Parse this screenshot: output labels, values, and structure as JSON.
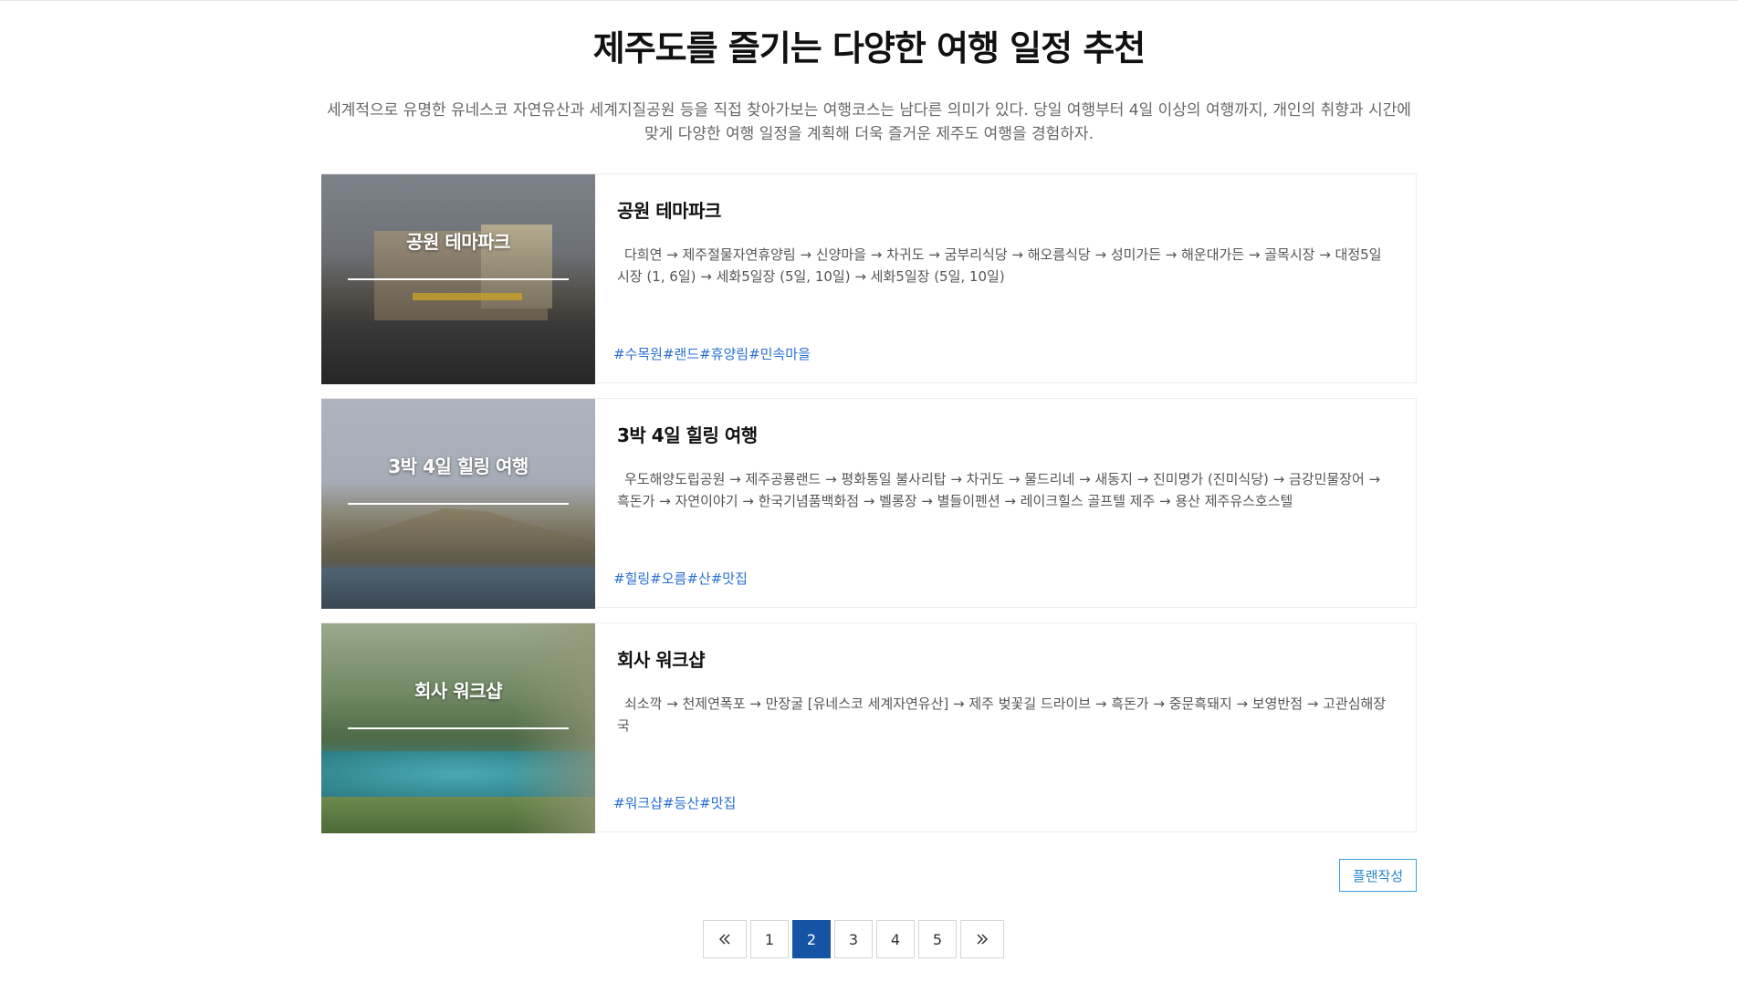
{
  "header": {
    "title": "제주도를 즐기는 다양한 여행 일정 추천",
    "description": "세계적으로 유명한 유네스코 자연유산과 세계지질공원 등을 직접 찾아가보는 여행코스는 남다른 의미가 있다. 당일 여행부터 4일 이상의 여행까지, 개인의 취향과 시간에 맞게 다양한 여행 일정을 계획해 더욱 즐거운 제주도 여행을 경험하자."
  },
  "courses": [
    {
      "thumb_label": "공원 테마파크",
      "title": "공원 테마파크",
      "route": "다희연 → 제주절물자연휴양림 → 신양마을 → 차귀도 → 굼부리식당 → 해오름식당 → 성미가든 → 해운대가든 → 골목시장 → 대정5일시장 (1, 6일) → 세화5일장 (5일, 10일) → 세화5일장 (5일, 10일)",
      "tags": [
        "#수목원",
        "#랜드",
        "#휴양림",
        "#민속마을"
      ]
    },
    {
      "thumb_label": "3박 4일 힐링 여행",
      "title": "3박 4일 힐링 여행",
      "route": "우도해양도립공원 → 제주공룡랜드 → 평화통일 불사리탑 → 차귀도 → 물드리네 → 새동지 → 진미명가 (진미식당) → 금강민물장어 → 흑돈가 → 자연이야기 → 한국기념품백화점 → 벨롱장 → 별들이펜션 → 레이크힐스 골프텔 제주 → 용산 제주유스호스텔",
      "tags": [
        "#힐링",
        "#오름",
        "#산",
        "#맛집"
      ]
    },
    {
      "thumb_label": "회사 워크샵",
      "title": "회사 워크샵",
      "route": "쇠소깍 → 천제연폭포 → 만장굴 [유네스코 세계자연유산] → 제주 벚꽃길 드라이브 → 흑돈가 → 중문흑돼지 → 보영반점 → 고관심해장국",
      "tags": [
        "#워크샵",
        "#등산",
        "#맛집"
      ]
    }
  ],
  "actions": {
    "plan_label": "플랜작성"
  },
  "pagination": {
    "prev_icon": "double-chevron-left-icon",
    "next_icon": "double-chevron-right-icon",
    "pages": [
      "1",
      "2",
      "3",
      "4",
      "5"
    ],
    "current": "2"
  },
  "colors": {
    "accent": "#1553a4",
    "tag": "#2a6fd1",
    "button_border": "#3aa0d8"
  }
}
